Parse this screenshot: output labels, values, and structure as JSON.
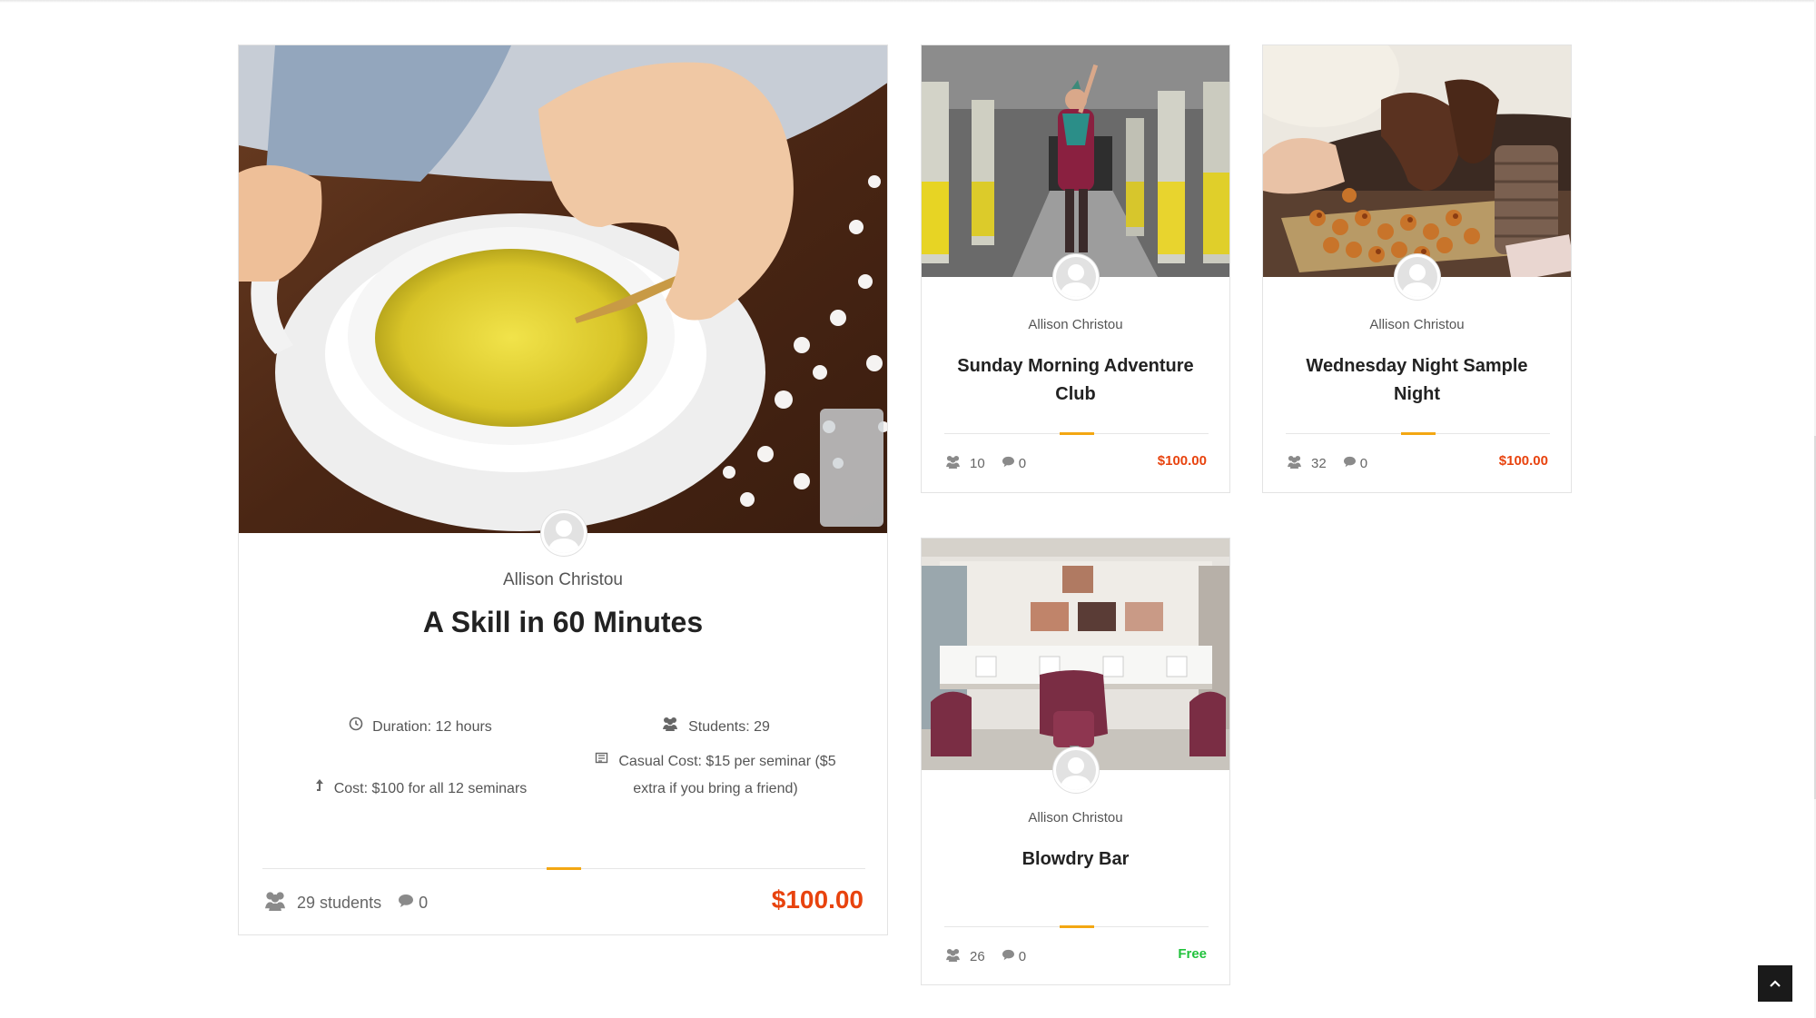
{
  "colors": {
    "price_accent": "#e8430e",
    "free_accent": "#21c23c",
    "divider_accent": "#f3a712",
    "border": "#e3e3e3"
  },
  "courses": [
    {
      "id": "skill-60",
      "author": "Allison Christou",
      "title": "A Skill in 60 Minutes",
      "details": {
        "duration": "Duration: 12 hours",
        "students": "Students: 29",
        "cost": "Cost: $100 for all 12 seminars",
        "casual_cost_line1": "Casual Cost: $15 per seminar ($5",
        "casual_cost_line2": "extra if you bring a friend)"
      },
      "students_label": "29 students",
      "comments": "0",
      "price": "$100.00",
      "image_icon": "tea-cup-photo"
    },
    {
      "id": "sunday-morning",
      "author": "Allison Christou",
      "title_line1": "Sunday Morning Adventure",
      "title_line2": "Club",
      "students": "10",
      "comments": "0",
      "price": "$100.00",
      "image_icon": "graffiti-tunnel-photo"
    },
    {
      "id": "wednesday-night",
      "author": "Allison Christou",
      "title_line1": "Wednesday Night Sample",
      "title_line2": "Night",
      "students": "32",
      "comments": "0",
      "price": "$100.00",
      "image_icon": "food-platter-photo"
    },
    {
      "id": "blowdry-bar",
      "author": "Allison Christou",
      "title_line1": "Blowdry Bar",
      "students": "26",
      "comments": "0",
      "price": "Free",
      "image_icon": "salon-interior-photo"
    }
  ],
  "icons": {
    "students": "users-icon",
    "comments": "comment-icon",
    "duration": "clock-icon",
    "cost": "arrow-icon",
    "casual_cost": "ticket-icon",
    "scroll_top": "chevron-up-icon",
    "avatar": "user-avatar-icon"
  }
}
